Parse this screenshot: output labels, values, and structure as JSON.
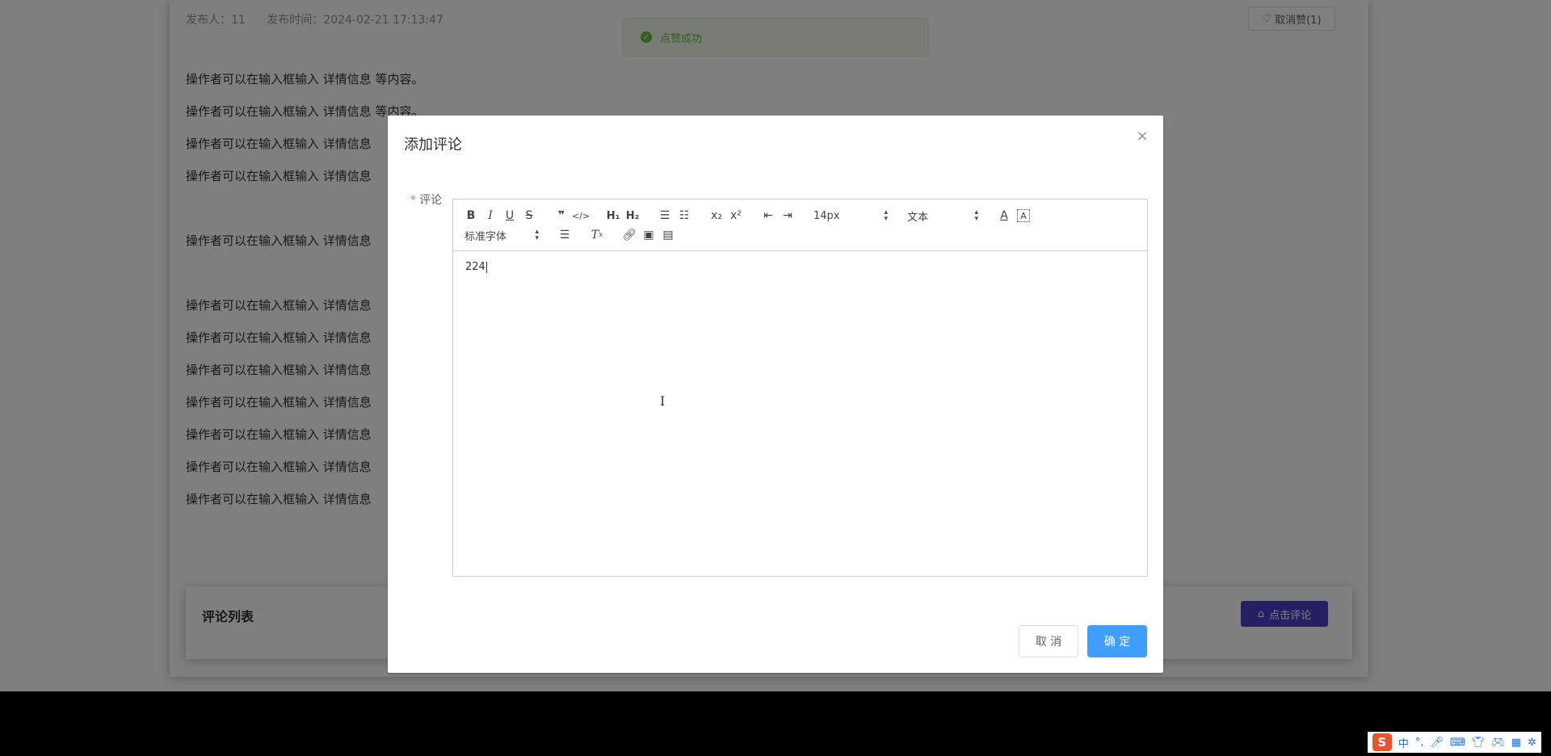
{
  "article": {
    "publisher_label": "发布人：11",
    "publish_time_label": "发布时间：2024-02-21 17:13:47",
    "unlike_button": "取消赞(1)",
    "paragraphs": [
      "操作者可以在输入框输入 详情信息 等内容。",
      "操作者可以在输入框输入 详情信息 等内容。",
      "操作者可以在输入框输入 详情信息",
      "操作者可以在输入框输入 详情信息",
      "操作者可以在输入框输入 详情信息",
      "操作者可以在输入框输入 详情信息",
      "操作者可以在输入框输入 详情信息",
      "操作者可以在输入框输入 详情信息",
      "操作者可以在输入框输入 详情信息",
      "操作者可以在输入框输入 详情信息",
      "操作者可以在输入框输入 详情信息",
      "操作者可以在输入框输入 详情信息"
    ]
  },
  "toast": {
    "message": "点赞成功",
    "color": "#67c23a"
  },
  "comment_panel": {
    "title": "评论列表",
    "button_label": "点击评论",
    "button_color": "#4a3fc9"
  },
  "dialog": {
    "title": "添加评论",
    "field_label": "评论",
    "editor": {
      "font_size": "14px",
      "header_select": "文本",
      "font_family": "标准字体",
      "content": "224"
    },
    "cancel_label": "取 消",
    "ok_label": "确 定",
    "ok_color": "#409eff"
  },
  "taskbar": {
    "ime_logo": "S",
    "ime_mode": "中"
  }
}
